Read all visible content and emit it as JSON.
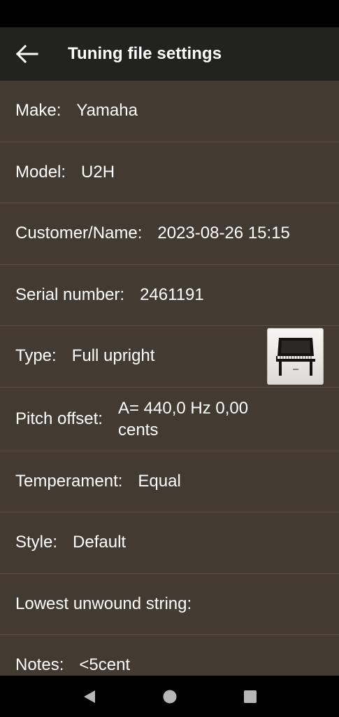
{
  "header": {
    "title": "Tuning file settings"
  },
  "rows": [
    {
      "label": "Make:",
      "value": "Yamaha"
    },
    {
      "label": "Model:",
      "value": "U2H"
    },
    {
      "label": "Customer/Name:",
      "value": "2023-08-26 15:15"
    },
    {
      "label": "Serial number:",
      "value": "2461191"
    },
    {
      "label": "Type:",
      "value": "Full upright"
    },
    {
      "label": "Pitch offset:",
      "value": "A= 440,0 Hz   0,00 cents"
    },
    {
      "label": "Temperament:",
      "value": "Equal"
    },
    {
      "label": "Style:",
      "value": "Default"
    },
    {
      "label": "Lowest unwound string:",
      "value": ""
    },
    {
      "label": "Notes:",
      "value": "<5cent"
    }
  ],
  "icons": {
    "back": "arrow-left-icon",
    "piano": "upright-piano-icon",
    "nav_back": "triangle-back-icon",
    "nav_home": "circle-home-icon",
    "nav_recents": "square-recents-icon"
  },
  "colors": {
    "app_bar": "#222221",
    "background": "#433a31",
    "divider": "#5a5047",
    "text": "#ffffff"
  }
}
